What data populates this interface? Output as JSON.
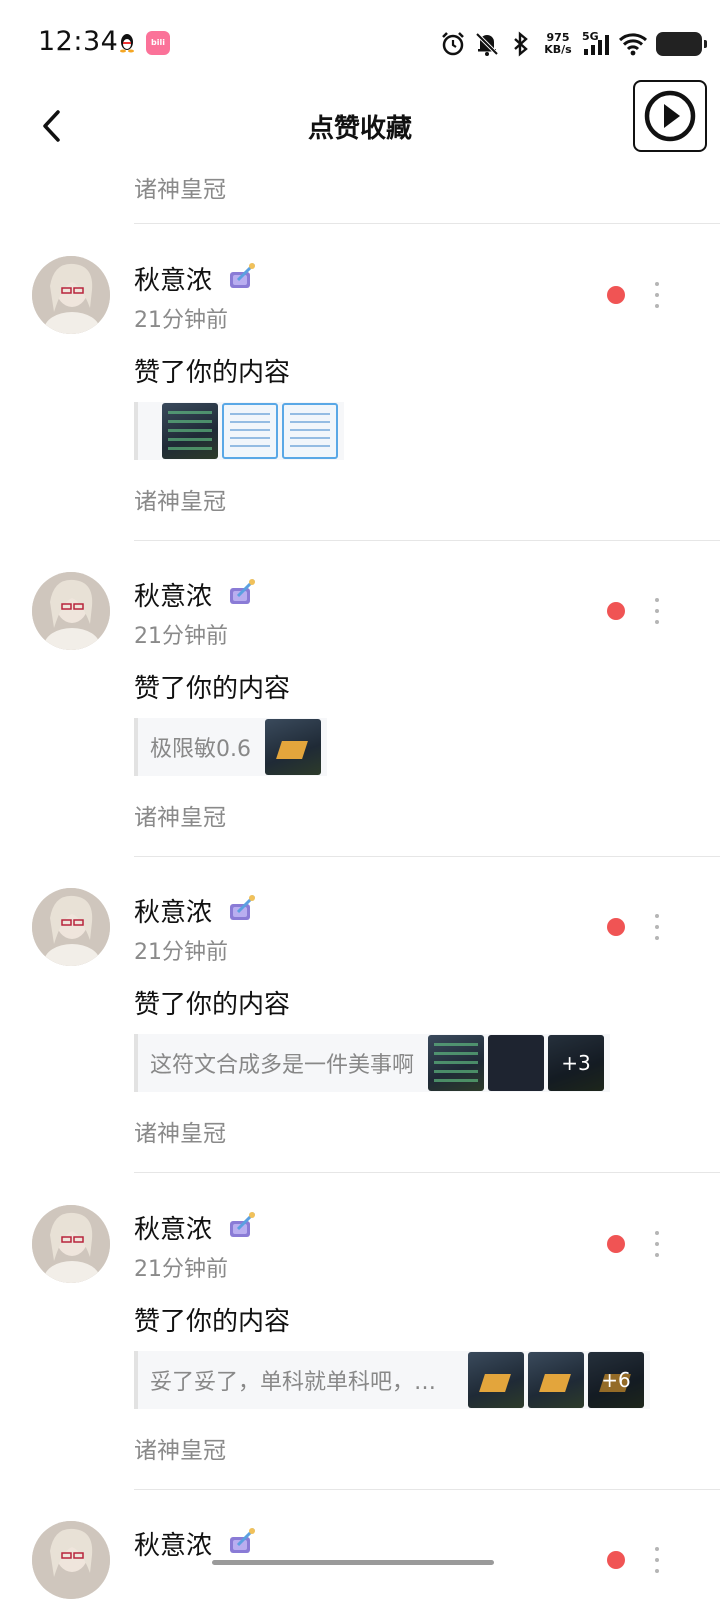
{
  "status_bar": {
    "time": "12:34",
    "net_speed_value": "975",
    "net_speed_unit": "KB/s",
    "signal_label": "5G",
    "icons": [
      "qq-penguin-icon",
      "bilibili-icon",
      "alarm-icon",
      "bell-off-icon",
      "bluetooth-icon",
      "signal-icon",
      "wifi-icon",
      "battery-icon"
    ]
  },
  "header": {
    "title": "点赞收藏",
    "back_icon": "chevron-left-icon",
    "play_icon": "play-circle-icon"
  },
  "top_partial_source": "诸神皇冠",
  "items": [
    {
      "user_name": "秋意浓",
      "time": "21分钟前",
      "action": "赞了你的内容",
      "quote_text": "",
      "thumbs": [
        "dark",
        "light",
        "light"
      ],
      "more_count": "",
      "source": "诸神皇冠"
    },
    {
      "user_name": "秋意浓",
      "time": "21分钟前",
      "action": "赞了你的内容",
      "quote_text": "极限敏0.6",
      "thumbs": [
        "dark"
      ],
      "more_count": "",
      "source": "诸神皇冠"
    },
    {
      "user_name": "秋意浓",
      "time": "21分钟前",
      "action": "赞了你的内容",
      "quote_text": "这符文合成多是一件美事啊",
      "thumbs": [
        "dark",
        "dark",
        "dark"
      ],
      "more_count": "+3",
      "source": "诸神皇冠"
    },
    {
      "user_name": "秋意浓",
      "time": "21分钟前",
      "action": "赞了你的内容",
      "quote_text": "妥了妥了，单科就单科吧，…",
      "thumbs": [
        "dark",
        "dark",
        "dark"
      ],
      "more_count": "+6",
      "source": "诸神皇冠"
    },
    {
      "user_name": "秋意浓",
      "time": "",
      "action": "",
      "quote_text": "",
      "thumbs": [],
      "more_count": "",
      "source": ""
    }
  ],
  "colors": {
    "unread_dot": "#f05454",
    "secondary_text": "#8a8a8a",
    "primary_text": "#111111"
  }
}
